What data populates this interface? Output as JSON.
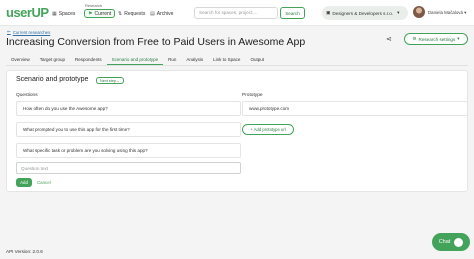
{
  "header": {
    "logo": "userUP",
    "nav": {
      "research_label": "Research",
      "spaces": "Spaces",
      "current": "Current",
      "requests": "Requests",
      "archive": "Archive"
    },
    "search_placeholder": "Search for spaces, project,...",
    "search_button": "Search",
    "org_name": "Designers & Developers s.r.o.",
    "user_name": "Daniela Mačalová"
  },
  "breadcrumb": "Current researches",
  "page_title": "Increasing Conversion from Free to Paid Users in Awesome App",
  "settings_button": "Research settings",
  "tabs": [
    {
      "label": "Overview",
      "active": false
    },
    {
      "label": "Target group",
      "active": false
    },
    {
      "label": "Respondents",
      "active": false
    },
    {
      "label": "Scenario and prototype",
      "active": true
    },
    {
      "label": "Run",
      "active": false
    },
    {
      "label": "Analysis",
      "active": false
    },
    {
      "label": "Link to Space",
      "active": false
    },
    {
      "label": "Output",
      "active": false
    }
  ],
  "section": {
    "title": "Scenario and prototype",
    "next_step": "Next step",
    "questions_label": "Questions",
    "prototype_label": "Prototype",
    "questions": [
      "How often do you use the Awesome app?",
      "What prompted you to use this app for the first time?",
      "What specific task or problem are you solving using this app?"
    ],
    "question_placeholder": "Question text",
    "add_button": "Add",
    "cancel_link": "Cancel",
    "prototype_url": "www.prototype.com",
    "add_prototype_button": "Add prototype url"
  },
  "footer": {
    "api_version": "API Version: 2.0.6",
    "chat": "Chat"
  },
  "colors": {
    "accent": "#43a35a",
    "accent_dark": "#2f7c45",
    "background": "#f3f4f3"
  }
}
